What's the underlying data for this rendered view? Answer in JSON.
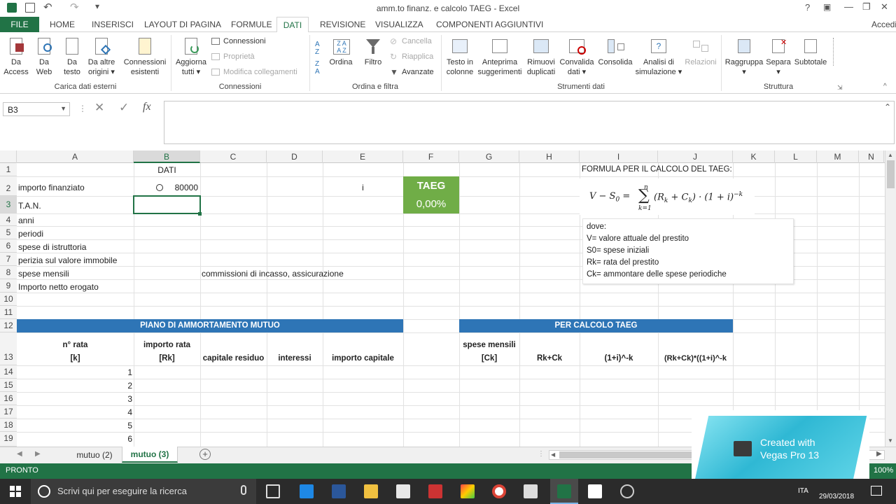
{
  "window": {
    "title": "amm.to finanz. e calcolo TAEG - Excel"
  },
  "titlebar_buttons": {
    "help": "?",
    "minimize": "—",
    "restore": "❐",
    "close": "✕"
  },
  "ribbon": {
    "tabs": [
      "FILE",
      "HOME",
      "INSERISCI",
      "LAYOUT DI PAGINA",
      "FORMULE",
      "DATI",
      "REVISIONE",
      "VISUALIZZA",
      "COMPONENTI AGGIUNTIVI"
    ],
    "active_tab": "DATI",
    "account": "Accedi",
    "groups": {
      "external": {
        "label": "Carica dati esterni",
        "buttons": [
          {
            "l1": "Da",
            "l2": "Access"
          },
          {
            "l1": "Da",
            "l2": "Web"
          },
          {
            "l1": "Da",
            "l2": "testo"
          },
          {
            "l1": "Da altre",
            "l2": "origini ▾"
          },
          {
            "l1": "Connessioni",
            "l2": "esistenti"
          }
        ]
      },
      "connections": {
        "label": "Connessioni",
        "refresh": {
          "l1": "Aggiorna",
          "l2": "tutti ▾"
        },
        "items": [
          "Connessioni",
          "Proprietà",
          "Modifica collegamenti"
        ]
      },
      "sort": {
        "label": "Ordina e filtra",
        "sort_btn": "Ordina",
        "filter_btn": "Filtro",
        "items": [
          "Cancella",
          "Riapplica",
          "Avanzate"
        ]
      },
      "tools": {
        "label": "Strumenti dati",
        "buttons": [
          {
            "l1": "Testo in",
            "l2": "colonne"
          },
          {
            "l1": "Anteprima",
            "l2": "suggerimenti"
          },
          {
            "l1": "Rimuovi",
            "l2": "duplicati"
          },
          {
            "l1": "Convalida",
            "l2": "dati ▾"
          },
          {
            "l1": "Consolida",
            "l2": ""
          },
          {
            "l1": "Analisi di",
            "l2": "simulazione ▾"
          },
          {
            "l1": "Relazioni",
            "l2": ""
          }
        ]
      },
      "outline": {
        "label": "Struttura",
        "buttons": [
          {
            "l1": "Raggruppa",
            "l2": "▾"
          },
          {
            "l1": "Separa",
            "l2": "▾"
          },
          {
            "l1": "Subtotale",
            "l2": ""
          }
        ]
      }
    }
  },
  "formula_bar": {
    "name_box": "B3",
    "fx": "fx",
    "cancel": "✕",
    "enter": "✓",
    "value": ""
  },
  "columns": [
    "A",
    "B",
    "C",
    "D",
    "E",
    "F",
    "G",
    "H",
    "I",
    "J",
    "K",
    "L",
    "M",
    "N"
  ],
  "rows": [
    "1",
    "2",
    "3",
    "4",
    "5",
    "6",
    "7",
    "8",
    "9",
    "10",
    "11",
    "12",
    "13",
    "14",
    "15",
    "16",
    "17",
    "18",
    "19"
  ],
  "cells": {
    "B1": "DATI",
    "A2": "importo finanziato",
    "B2": "80000",
    "E2": "i",
    "A3": "T.A.N.",
    "A4": "anni",
    "A5": "periodi",
    "A6": "spese di istruttoria",
    "A7": "perizia sul valore immobile",
    "A8": "spese mensili",
    "C8": "commissioni di incasso, assicurazione",
    "A9": "Importo netto erogato",
    "header_piano": "PIANO DI AMMORTAMENTO MUTUO",
    "header_taeg": "PER CALCOLO TAEG",
    "A13_1": "n° rata",
    "A13_2": "[k]",
    "B13_1": "importo rata",
    "B13_2": "[Rk]",
    "C13": "capitale residuo",
    "D13": "interessi",
    "E13": "importo capitale",
    "G13_1": "spese mensili",
    "G13_2": "[Ck]",
    "H13": "Rk+Ck",
    "I13": "(1+i)^-k",
    "J13": "(Rk+Ck)*((1+i)^-k",
    "A14": "1",
    "A15": "2",
    "A16": "3",
    "A17": "4",
    "A18": "5",
    "A19": "6"
  },
  "taeg_box": {
    "label": "TAEG",
    "value": "0,00%"
  },
  "formula_note": {
    "title": "FORMULA PER IL CALCOLO DEL TAEG:",
    "formula_left": "V − S",
    "formula_sub0": "0",
    "formula_eq": " = ",
    "sum_top": "n",
    "sum_bottom": "k=1",
    "formula_right": "(R",
    "formula_rest": " + C",
    "formula_end": ") · (1 + i)",
    "formula_exp": "−k"
  },
  "legend_box": {
    "lines": [
      "dove:",
      "V= valore attuale del prestito",
      "S0= spese iniziali",
      "Rk= rata del prestito",
      "Ck= ammontare delle spese periodiche"
    ]
  },
  "sheets": {
    "tabs": [
      "mutuo (2)",
      "mutuo (3)"
    ],
    "active": "mutuo (3)"
  },
  "status": {
    "text": "PRONTO",
    "zoom": "100%"
  },
  "watermark": {
    "l1": "Created with",
    "l2": "Vegas Pro 13"
  },
  "taskbar": {
    "search_placeholder": "Scrivi qui per eseguire la ricerca",
    "lang": "ITA",
    "date": "29/03/2018"
  },
  "colors": {
    "excel_green": "#217346",
    "header_blue": "#2e75b6",
    "taeg_green": "#70ad47"
  }
}
